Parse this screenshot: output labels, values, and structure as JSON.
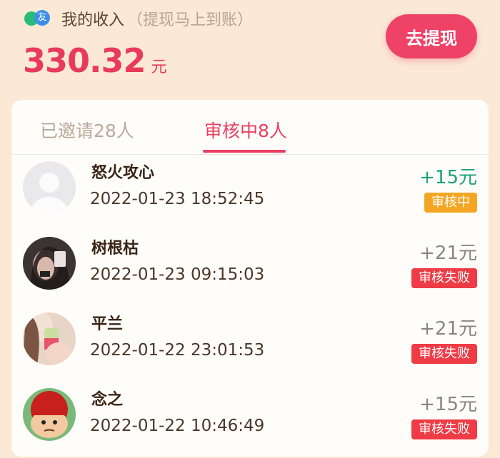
{
  "income": {
    "label": "我的收入",
    "hint": "（提现马上到账）",
    "amount": "330.32",
    "unit": "元",
    "withdraw_label": "去提现"
  },
  "brand": {
    "icon": "wechat-friend-icon",
    "glyph": "友"
  },
  "tabs": [
    {
      "label": "已邀请28人",
      "active": false
    },
    {
      "label": "审核中8人",
      "active": true
    }
  ],
  "records": [
    {
      "name": "怒火攻心",
      "time": "2022-01-23 18:52:45",
      "reward": "+15元",
      "status": "审核中",
      "status_color": "#f4a623",
      "reward_color": "#1ba37a"
    },
    {
      "name": "树根枯",
      "time": "2022-01-23 09:15:03",
      "reward": "+21元",
      "status": "审核失败",
      "status_color": "#ee3b45",
      "reward_color": "#8c8480"
    },
    {
      "name": "平兰",
      "time": "2022-01-22 23:01:53",
      "reward": "+21元",
      "status": "审核失败",
      "status_color": "#ee3b45",
      "reward_color": "#8c8480"
    },
    {
      "name": "念之",
      "time": "2022-01-22 10:46:49",
      "reward": "+15元",
      "status": "审核失败",
      "status_color": "#ee3b45",
      "reward_color": "#8c8480"
    }
  ],
  "colors": {
    "accent": "#e83f62",
    "background": "#fbe9d6"
  }
}
